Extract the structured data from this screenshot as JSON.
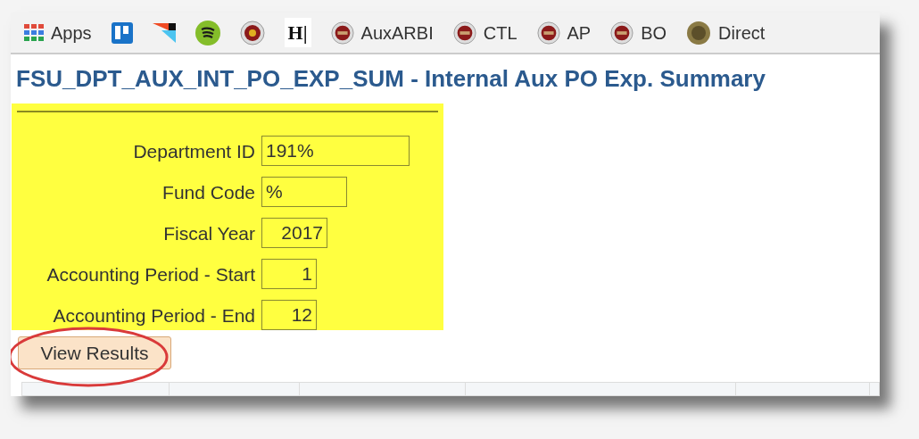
{
  "bookmarks": [
    {
      "kind": "apps",
      "label": "Apps"
    },
    {
      "kind": "board"
    },
    {
      "kind": "flag"
    },
    {
      "kind": "green"
    },
    {
      "kind": "seal-gold"
    },
    {
      "kind": "letter",
      "label": "H|"
    },
    {
      "kind": "seal",
      "label": "AuxARBI"
    },
    {
      "kind": "seal",
      "label": "CTL"
    },
    {
      "kind": "seal",
      "label": "AP"
    },
    {
      "kind": "seal",
      "label": "BO"
    },
    {
      "kind": "seal-bronze",
      "label": "Direct"
    }
  ],
  "title": "FSU_DPT_AUX_INT_PO_EXP_SUM - Internal Aux PO Exp. Summary",
  "fields": [
    {
      "label": "Department ID",
      "value": "191%"
    },
    {
      "label": "Fund Code",
      "value": "%"
    },
    {
      "label": "Fiscal Year",
      "value": "2017"
    },
    {
      "label": "Accounting Period - Start",
      "value": "1"
    },
    {
      "label": "Accounting Period - End",
      "value": "12"
    }
  ],
  "button": {
    "label": "View Results"
  }
}
